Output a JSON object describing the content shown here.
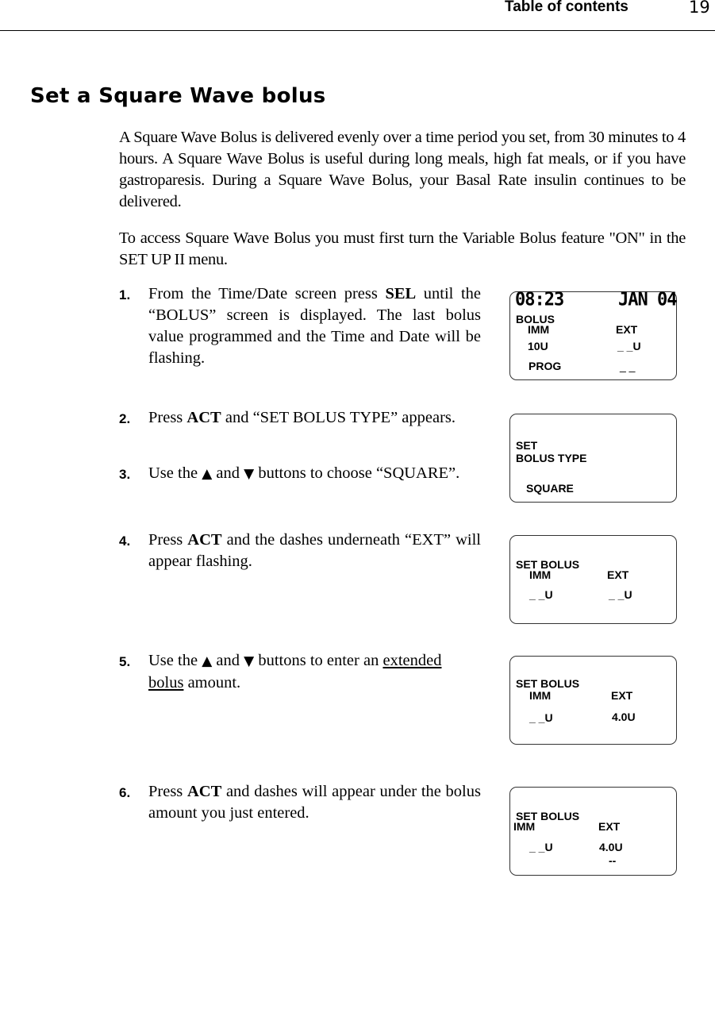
{
  "header": {
    "title": "Table of contents",
    "page_number": "19"
  },
  "section": {
    "title": "Set a Square Wave bolus"
  },
  "paragraphs": [
    "A Square Wave Bolus is delivered evenly over a time period you set, from 30 minutes to 4 hours. A Square Wave Bolus is useful during long meals, high fat meals, or if you have gastroparesis. During a Square Wave Bolus, your Basal Rate insulin continues to be delivered.",
    "To access Square Wave Bolus you must first turn the Variable Bolus feature \"ON\" in the SET UP II menu."
  ],
  "steps": [
    {
      "num": "1.",
      "pre": "From the Time/Date screen press ",
      "bold": "SEL",
      "post": " until the “BOLUS” screen is displayed. The last bolus value programmed and the Time and Date will be flashing."
    },
    {
      "num": "2.",
      "pre": "Press ",
      "bold": "ACT",
      "post": " and “SET BOLUS TYPE” appears."
    },
    {
      "num": "3.",
      "pre": "Use the ",
      "up": "▲",
      "mid": " and ",
      "down": "▼",
      "post": " buttons to choose “SQUARE”."
    },
    {
      "num": "4.",
      "pre": "Press ",
      "bold": "ACT",
      "post": " and the dashes underneath “EXT” will appear flashing."
    },
    {
      "num": "5.",
      "pre": "Use the ",
      "up": "▲",
      "mid": " and ",
      "down": "▼",
      "post_a": " buttons to enter an ",
      "underline_a": "extended",
      "underline_b": "bolus",
      "post": " amount."
    },
    {
      "num": "6.",
      "pre": "Press ",
      "bold": "ACT",
      "post": " and dashes will appear under the bolus amount you just entered."
    }
  ],
  "screens": [
    {
      "time": "08:23",
      "date": "JAN 04",
      "title": "BOLUS",
      "imm_label": "IMM",
      "ext_label": "EXT",
      "imm_value": "10U",
      "ext_value": "_ _U",
      "prog_label": "PROG",
      "prog_value": "_ _"
    },
    {
      "line1": "SET",
      "line2": "BOLUS TYPE",
      "value": "SQUARE"
    },
    {
      "title": "SET BOLUS",
      "imm_label": "IMM",
      "ext_label": "EXT",
      "imm_value": "_ _U",
      "ext_value": "_ _U"
    },
    {
      "title": "SET BOLUS",
      "imm_label": "IMM",
      "ext_label": "EXT",
      "imm_value": "_ _U",
      "ext_value": "4.0U"
    },
    {
      "title": "SET BOLUS",
      "imm_label": "IMM",
      "ext_label": "EXT",
      "imm_value": "_ _U",
      "ext_value": "4.0U",
      "ext_marker": "--"
    }
  ]
}
